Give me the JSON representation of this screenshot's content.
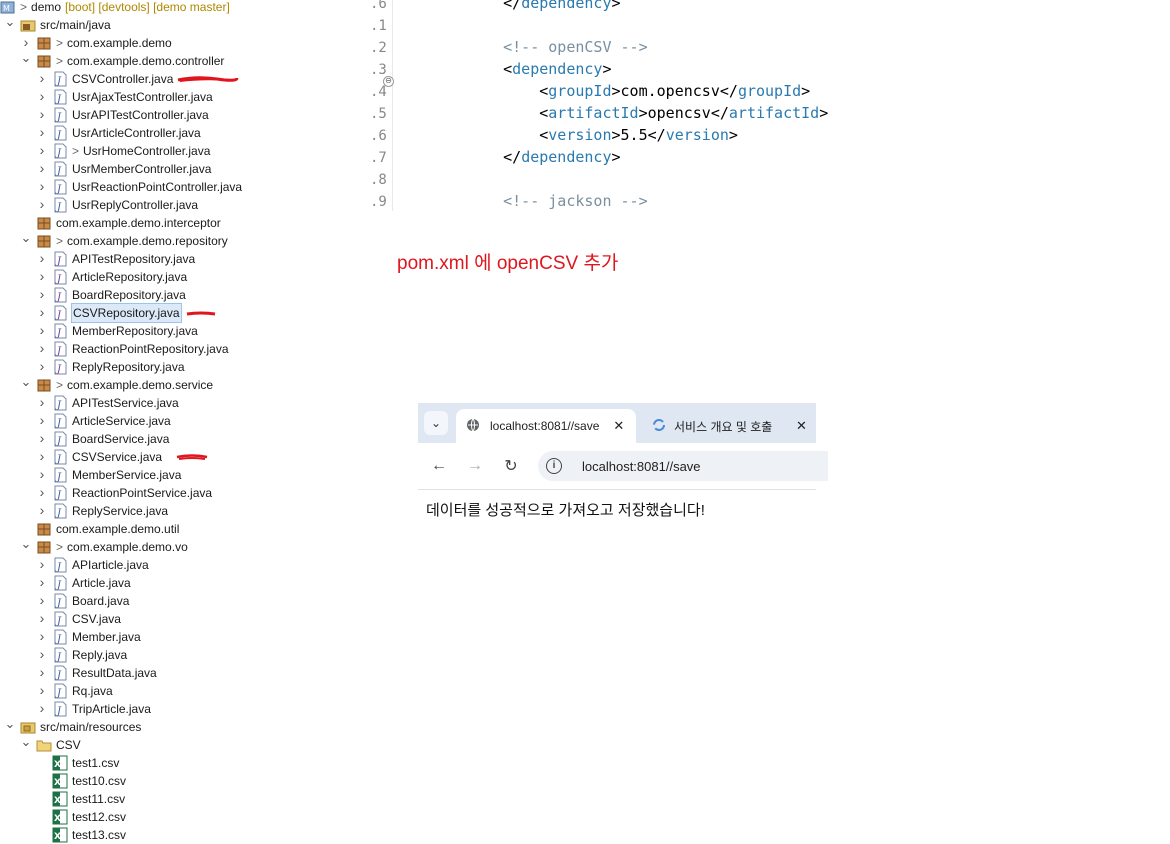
{
  "tree": {
    "project": {
      "name": "demo",
      "decoration": "[boot] [devtools] [demo master]"
    },
    "items": [
      {
        "label": "src/main/java"
      },
      {
        "label": "com.example.demo"
      },
      {
        "label": "com.example.demo.controller"
      },
      {
        "label": "CSVController.java"
      },
      {
        "label": "UsrAjaxTestController.java"
      },
      {
        "label": "UsrAPITestController.java"
      },
      {
        "label": "UsrArticleController.java"
      },
      {
        "label": "UsrHomeController.java"
      },
      {
        "label": "UsrMemberController.java"
      },
      {
        "label": "UsrReactionPointController.java"
      },
      {
        "label": "UsrReplyController.java"
      },
      {
        "label": "com.example.demo.interceptor"
      },
      {
        "label": "com.example.demo.repository"
      },
      {
        "label": "APITestRepository.java"
      },
      {
        "label": "ArticleRepository.java"
      },
      {
        "label": "BoardRepository.java"
      },
      {
        "label": "CSVRepository.java"
      },
      {
        "label": "MemberRepository.java"
      },
      {
        "label": "ReactionPointRepository.java"
      },
      {
        "label": "ReplyRepository.java"
      },
      {
        "label": "com.example.demo.service"
      },
      {
        "label": "APITestService.java"
      },
      {
        "label": "ArticleService.java"
      },
      {
        "label": "BoardService.java"
      },
      {
        "label": "CSVService.java"
      },
      {
        "label": "MemberService.java"
      },
      {
        "label": "ReactionPointService.java"
      },
      {
        "label": "ReplyService.java"
      },
      {
        "label": "com.example.demo.util"
      },
      {
        "label": "com.example.demo.vo"
      },
      {
        "label": "APIarticle.java"
      },
      {
        "label": "Article.java"
      },
      {
        "label": "Board.java"
      },
      {
        "label": "CSV.java"
      },
      {
        "label": "Member.java"
      },
      {
        "label": "Reply.java"
      },
      {
        "label": "ResultData.java"
      },
      {
        "label": "Rq.java"
      },
      {
        "label": "TripArticle.java"
      },
      {
        "label": "src/main/resources"
      },
      {
        "label": "CSV"
      },
      {
        "label": "test1.csv"
      },
      {
        "label": "test10.csv"
      },
      {
        "label": "test11.csv"
      },
      {
        "label": "test12.csv"
      },
      {
        "label": "test13.csv"
      }
    ]
  },
  "editor": {
    "line_numbers": [
      ".6",
      ".1",
      ".2",
      ".3",
      ".4",
      ".5",
      ".6",
      ".7",
      ".8",
      ".9"
    ],
    "lines": [
      {
        "indent": "    ",
        "parts": [
          [
            "p",
            "</"
          ],
          [
            "t",
            "dependency"
          ],
          [
            "p",
            ">"
          ]
        ]
      },
      {
        "indent": "",
        "parts": []
      },
      {
        "indent": "    ",
        "parts": [
          [
            "c",
            "<!-- openCSV -->"
          ]
        ]
      },
      {
        "indent": "    ",
        "parts": [
          [
            "p",
            "<"
          ],
          [
            "t",
            "dependency"
          ],
          [
            "p",
            ">"
          ]
        ]
      },
      {
        "indent": "        ",
        "parts": [
          [
            "p",
            "<"
          ],
          [
            "t",
            "groupId"
          ],
          [
            "p",
            ">com.opencsv</"
          ],
          [
            "t",
            "groupId"
          ],
          [
            "p",
            ">"
          ]
        ]
      },
      {
        "indent": "        ",
        "parts": [
          [
            "p",
            "<"
          ],
          [
            "t",
            "artifactId"
          ],
          [
            "p",
            ">opencsv</"
          ],
          [
            "t",
            "artifactId"
          ],
          [
            "p",
            ">"
          ]
        ]
      },
      {
        "indent": "        ",
        "parts": [
          [
            "p",
            "<"
          ],
          [
            "t",
            "version"
          ],
          [
            "p",
            ">5.5</"
          ],
          [
            "t",
            "version"
          ],
          [
            "p",
            ">"
          ]
        ]
      },
      {
        "indent": "    ",
        "parts": [
          [
            "p",
            "</"
          ],
          [
            "t",
            "dependency"
          ],
          [
            "p",
            ">"
          ]
        ]
      },
      {
        "indent": "",
        "parts": []
      },
      {
        "indent": "    ",
        "parts": [
          [
            "c",
            "<!-- jackson -->"
          ]
        ]
      }
    ]
  },
  "annotation": "pom.xml 에 openCSV 추가",
  "browser": {
    "tabs": [
      {
        "title": "localhost:8081//save",
        "close": "✕"
      },
      {
        "title": "서비스 개요 및 호출",
        "close": "✕"
      }
    ],
    "tab_search": "⌄",
    "nav": {
      "back": "←",
      "forward": "→",
      "reload": "↻"
    },
    "info_icon": "i",
    "url": "localhost:8081//save",
    "page_text": "데이터를 성공적으로 가져오고 저장했습니다!"
  }
}
